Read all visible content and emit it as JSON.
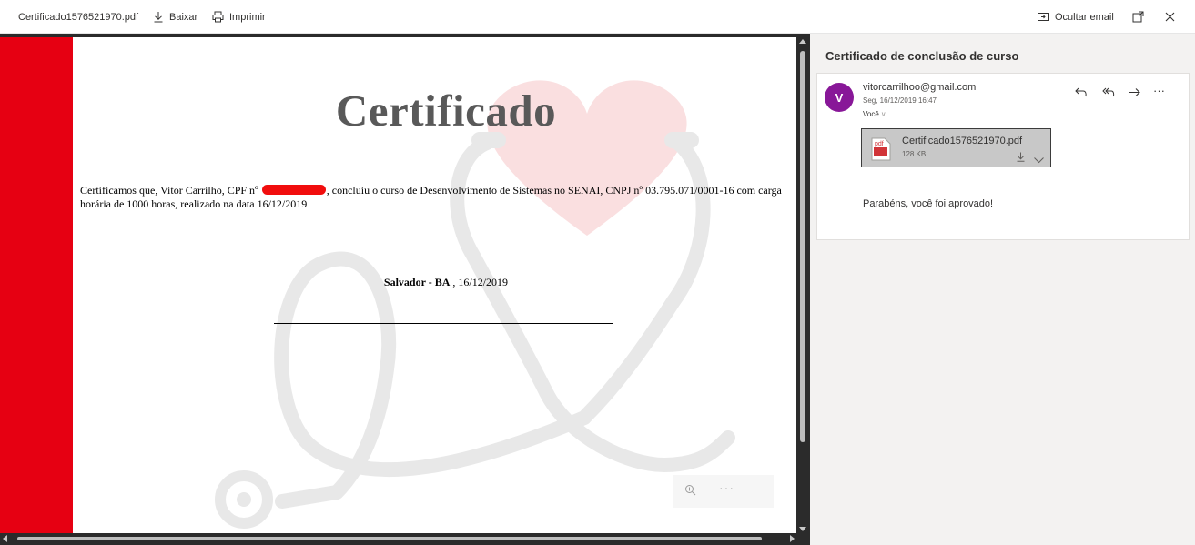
{
  "toolbar": {
    "filename": "Certificado1576521970.pdf",
    "download_label": "Baixar",
    "print_label": "Imprimir",
    "hide_email_label": "Ocultar email",
    "icons": [
      "download-icon",
      "printer-icon",
      "hide-email-icon",
      "popout-icon",
      "close-icon"
    ]
  },
  "document": {
    "title": "Certificado",
    "body_before_redaction": "Certificamos que, Vitor Carrilho, CPF nº ",
    "body_after_redaction": ", concluiu o curso de Desenvolvimento de Sistemas no SENAI, CNPJ nº 03.795.071/0001-16 com carga horária de 1000 horas, realizado na data 16/12/2019",
    "place_bold": "Salvador - BA",
    "place_date": " , 16/12/2019",
    "zoom_menu": "···",
    "accent_color": "#e60012"
  },
  "email": {
    "subject": "Certificado de conclusão de curso",
    "avatar_initial": "V",
    "avatar_color": "#881798",
    "sender": "vitorcarrilhoo@gmail.com",
    "sent": "Seg, 16/12/2019 16:47",
    "to": "Você",
    "actions": [
      "reply-icon",
      "reply-all-icon",
      "forward-icon",
      "more-icon"
    ],
    "more_label": "···",
    "attachment": {
      "name": "Certificado1576521970.pdf",
      "size": "128 KB",
      "icon_label": "pdf"
    },
    "body": "Parabéns, você foi aprovado!"
  }
}
